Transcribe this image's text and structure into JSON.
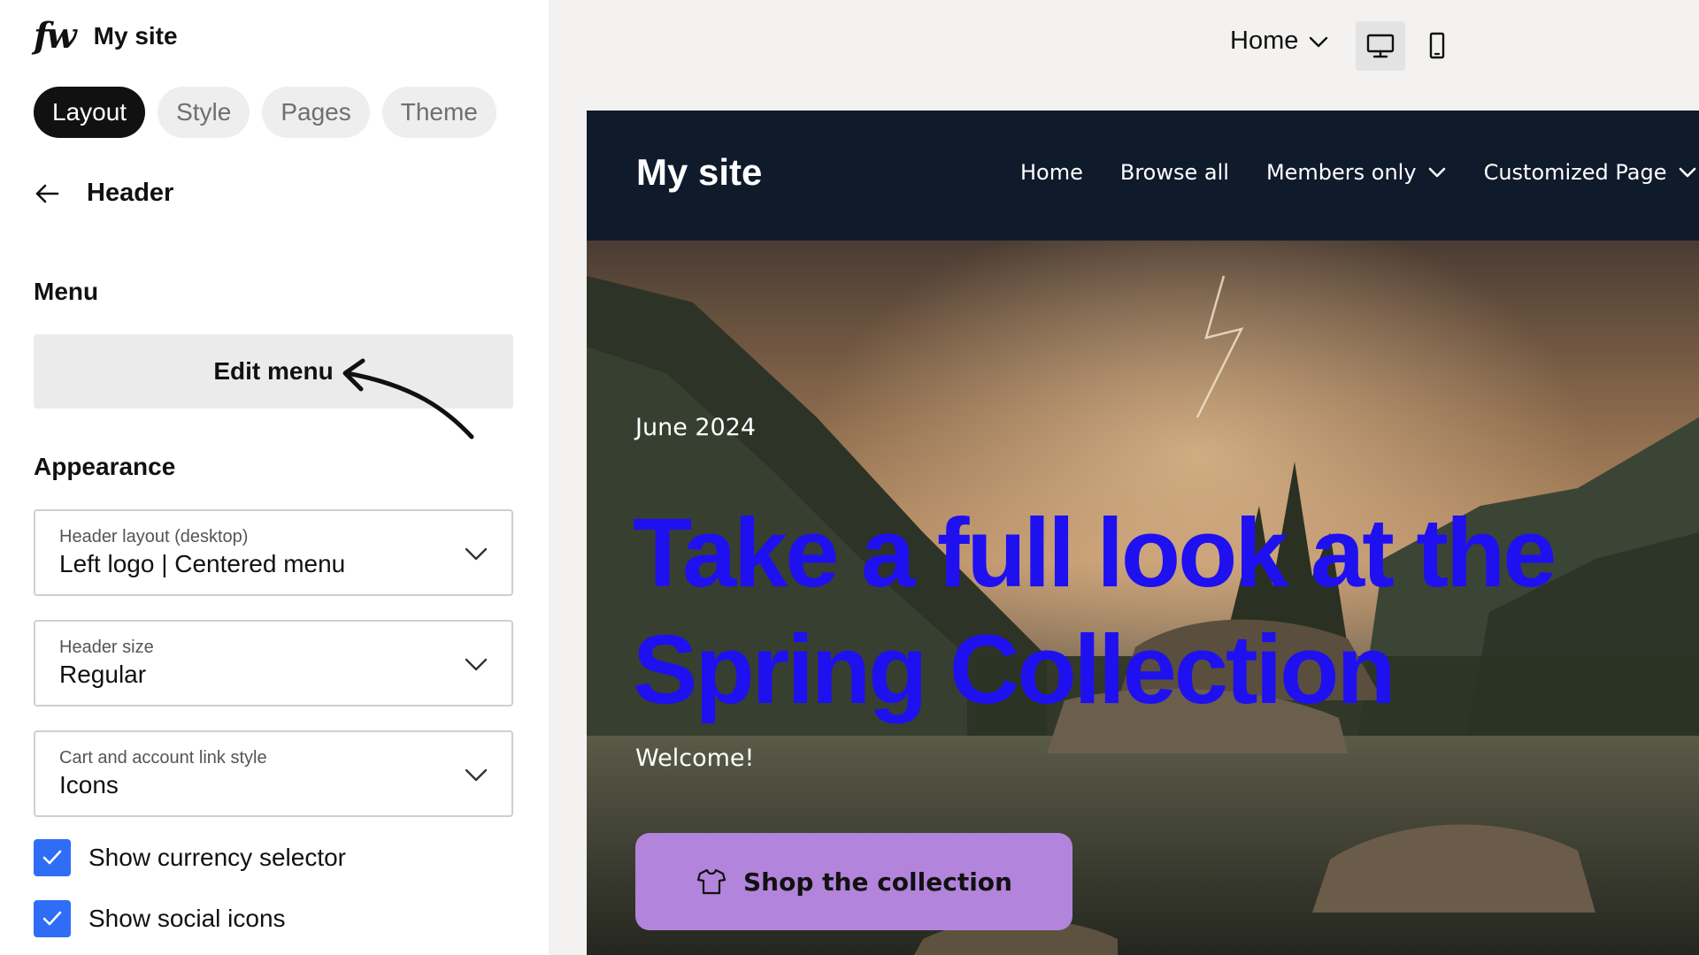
{
  "app": {
    "logo": "fw",
    "site_name": "My site"
  },
  "tabs": [
    {
      "label": "Layout",
      "active": true
    },
    {
      "label": "Style",
      "active": false
    },
    {
      "label": "Pages",
      "active": false
    },
    {
      "label": "Theme",
      "active": false
    }
  ],
  "panel": {
    "back_title": "Header",
    "menu_section": "Menu",
    "edit_menu_label": "Edit menu",
    "appearance_section": "Appearance",
    "selects": [
      {
        "label": "Header layout (desktop)",
        "value": "Left logo | Centered menu"
      },
      {
        "label": "Header size",
        "value": "Regular"
      },
      {
        "label": "Cart and account link style",
        "value": "Icons"
      }
    ],
    "checkboxes": [
      {
        "label": "Show currency selector",
        "checked": true
      },
      {
        "label": "Show social icons",
        "checked": true
      }
    ]
  },
  "toolbar": {
    "page_selector": "Home",
    "device": "desktop"
  },
  "preview": {
    "site_logo": "My site",
    "nav": [
      {
        "label": "Home",
        "dropdown": false
      },
      {
        "label": "Browse all",
        "dropdown": false
      },
      {
        "label": "Members only",
        "dropdown": true
      },
      {
        "label": "Customized Page",
        "dropdown": true
      }
    ],
    "hero": {
      "date": "June 2024",
      "title": "Take a full look at the Spring Collection",
      "subtitle": "Welcome!",
      "cta_label": "Shop the collection"
    }
  },
  "colors": {
    "accent_checkbox": "#2f6df6",
    "header_bg": "#0f1a2b",
    "hero_title": "#1f10f0",
    "cta_bg": "#b384db"
  },
  "icons": [
    "arrow-left-icon",
    "chevron-down-icon",
    "desktop-icon",
    "mobile-icon",
    "checkmark-icon",
    "tshirt-icon"
  ]
}
